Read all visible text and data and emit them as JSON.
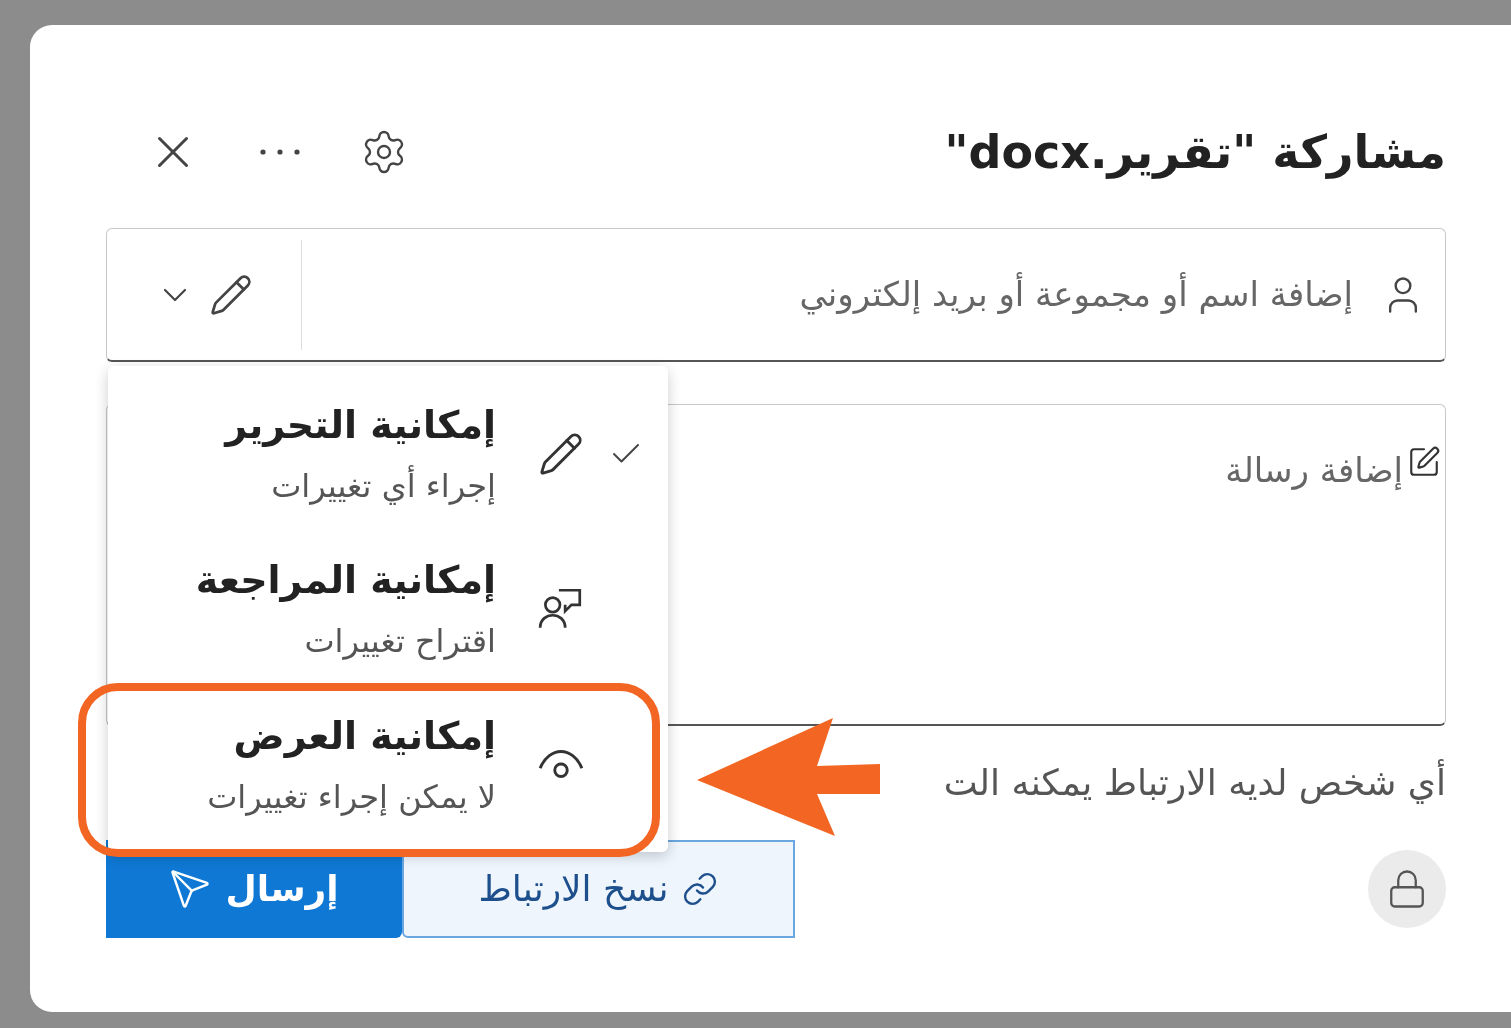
{
  "dialog": {
    "title": "مشاركة \"تقرير.docx\"",
    "recipients": {
      "placeholder": "إضافة اسم أو مجموعة أو بريد إلكتروني"
    },
    "message": {
      "placeholder": "إضافة رسالة"
    },
    "link_note": "أي شخص لديه الارتباط يمكنه الت",
    "buttons": [
      {
        "label": "نسخ الارتباط",
        "kind": "copy"
      },
      {
        "label": "إرسال",
        "kind": "send"
      }
    ]
  },
  "permission_menu": {
    "items": [
      {
        "kind": "edit",
        "title": "إمكانية التحرير",
        "subtitle": "إجراء أي تغييرات",
        "selected": true,
        "highlighted": false
      },
      {
        "kind": "review",
        "title": "إمكانية المراجعة",
        "subtitle": "اقتراح تغييرات",
        "selected": false,
        "highlighted": false
      },
      {
        "kind": "view",
        "title": "إمكانية العرض",
        "subtitle": "لا يمكن إجراء تغييرات",
        "selected": false,
        "highlighted": true
      }
    ]
  }
}
